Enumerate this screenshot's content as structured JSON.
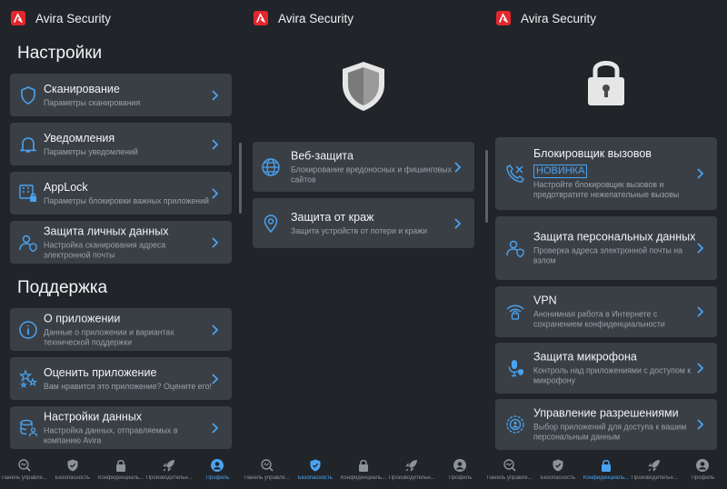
{
  "app": {
    "title": "Avira Security"
  },
  "screen1": {
    "settings_title": "Настройки",
    "support_title": "Поддержка",
    "settings_items": [
      {
        "title": "Сканирование",
        "subtitle": "Параметры сканирования",
        "icon": "shield-icon"
      },
      {
        "title": "Уведомления",
        "subtitle": "Параметры уведомлений",
        "icon": "bell-icon"
      },
      {
        "title": "AppLock",
        "subtitle": "Параметры блокировки важных приложений",
        "icon": "applock-icon"
      },
      {
        "title": "Защита личных данных",
        "subtitle": "Настройка сканирования адреса электронной почты",
        "icon": "user-shield-icon"
      }
    ],
    "support_items": [
      {
        "title": "О приложении",
        "subtitle": "Данные о приложении и вариантах технической поддержки",
        "icon": "info-icon"
      },
      {
        "title": "Оценить приложение",
        "subtitle": "Вам нравится это приложение? Оцените его!",
        "icon": "stars-icon"
      },
      {
        "title": "Настройки данных",
        "subtitle": "Настройка данных, отправляемых в компанию Avira",
        "icon": "database-user-icon"
      }
    ]
  },
  "screen2": {
    "items": [
      {
        "title": "Веб-защита",
        "subtitle": "Блокирование вредоносных и фишинговых сайтов",
        "icon": "globe-icon"
      },
      {
        "title": "Защита от краж",
        "subtitle": "Защита устройств от потери и кражи",
        "icon": "location-icon"
      }
    ]
  },
  "screen3": {
    "new_badge": "НОВИНКА",
    "items": [
      {
        "title": "Блокировщик вызовов",
        "subtitle": "Настройте блокировщик вызовов и предотвратите нежелательные вызовы",
        "icon": "call-block-icon"
      },
      {
        "title": "Защита персональных данных",
        "subtitle": "Проверка адреса электронной почты на взлом",
        "icon": "user-shield-icon"
      },
      {
        "title": "VPN",
        "subtitle": "Анонимная работа в Интернете с сохранением конфиденциальности",
        "icon": "vpn-icon"
      },
      {
        "title": "Защита микрофона",
        "subtitle": "Контроль над приложениями с доступом к микрофону",
        "icon": "microphone-icon"
      },
      {
        "title": "Управление разрешениями",
        "subtitle": "Выбор приложений для доступа к вашим персональным данным",
        "icon": "permissions-icon"
      }
    ]
  },
  "nav": {
    "screen1": [
      "Панель управле...",
      "Безопасность",
      "Конфиденциаль...",
      "Производительн...",
      "Профиль"
    ],
    "screen2": [
      "Панель управле...",
      "Безопасность",
      "Конфиденциаль...",
      "Производительн...",
      "Профиль"
    ],
    "screen3": [
      "Панель управле...",
      "Безопасность",
      "Конфиденциаль...",
      "Производительн...",
      "Профиль"
    ]
  },
  "colors": {
    "accent": "#4aa3f0",
    "card": "#3a3f46",
    "background": "#21252a",
    "brand": "#e3262e"
  }
}
